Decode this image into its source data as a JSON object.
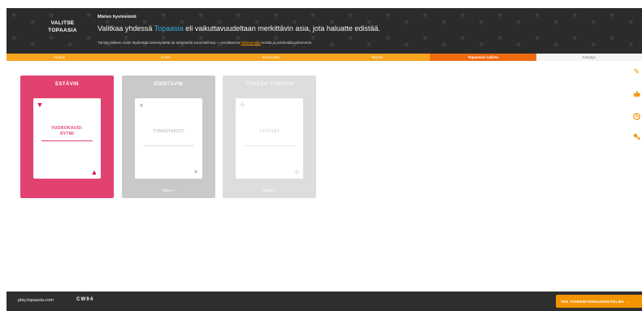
{
  "header": {
    "brand_line1": "VALITSE",
    "brand_line2": "TOPAASIA",
    "small_title": "Mielen hyvinvointi",
    "main_before": "Valitkaa yhdessä ",
    "main_highlight": "Topaasia",
    "main_after": " eli vaikuttavuudeltaan merkittävin asia, jota haluatte edistää.",
    "sub_before": "Tämän jälkeen voitte täydentää toimenpiteitä tai tarkastella suunnitelmaa — tarvittaessa ",
    "sub_link": "klikkaamalla",
    "sub_after": " korttia ja pohtimalla tarkemmin."
  },
  "tabs": [
    {
      "label": "Aloitus",
      "state": "done"
    },
    {
      "label": "Kortit",
      "state": "done"
    },
    {
      "label": "Keskustelu",
      "state": "done"
    },
    {
      "label": "Tavoite",
      "state": "done"
    },
    {
      "label": "Topaasian valinta",
      "state": "active"
    },
    {
      "label": "Kiteytys",
      "state": "next"
    }
  ],
  "cards": [
    {
      "title": "ESTÄVIN",
      "label_line1": "VUOROKAUSI-",
      "label_line2": "RYTMI",
      "choose": ""
    },
    {
      "title": "EDISTÄVIN",
      "label_line1": "TUNNETAIDOT",
      "label_line2": "",
      "choose": "Valitse +"
    },
    {
      "title": "TÄNÄÄN TÄRKEIN",
      "label_line1": "YSTÄVÄT",
      "label_line2": "",
      "choose": "Valitse +"
    }
  ],
  "side_icons": [
    "pencil-icon",
    "thumbs-up-icon",
    "clock-icon",
    "key-icon"
  ],
  "footer": {
    "url": "play.topaasia.com",
    "code": "CW94",
    "button_label": "TEE TOIMENPIDESUUNNITELMA →"
  },
  "colors": {
    "accent_orange": "#f29400",
    "active_tab": "#f06a10",
    "card_pink": "#e2426f",
    "highlight_blue": "#33a9d8"
  }
}
